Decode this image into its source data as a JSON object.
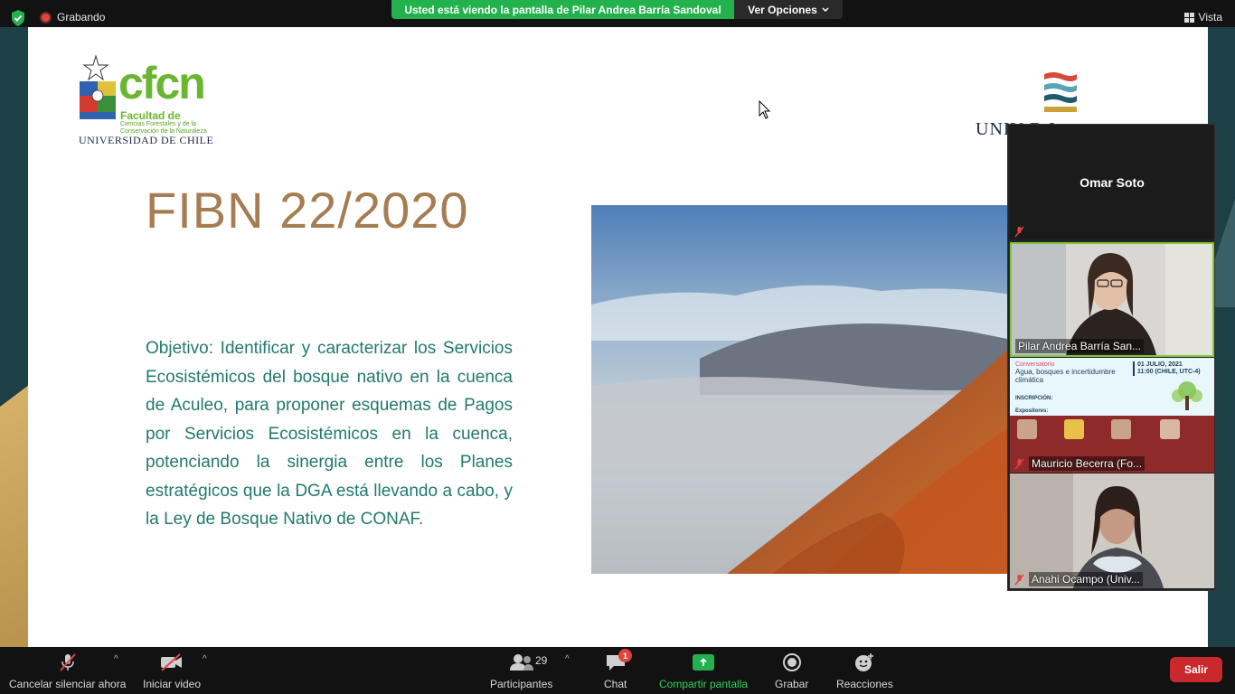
{
  "top_bar": {
    "recording_label": "Grabando",
    "share_banner": "Usted está viendo la pantalla de Pilar Andrea Barría Sandoval",
    "view_options_label": "Ver Opciones",
    "view_label": "Vista"
  },
  "slide": {
    "logo_left": {
      "brand": "cfcn",
      "faculty_line1": "Facultad de",
      "faculty_line2": "Ciencias Forestales y de la Conservación de la Naturaleza",
      "university": "UNIVERSIDAD DE CHILE"
    },
    "logo_right": {
      "text": "UNIV            D      I"
    },
    "title": "FIBN 22/2020",
    "body": "Objetivo: Identificar y caracterizar los Servicios Ecosistémicos del bosque nativo en la cuenca de Aculeo, para proponer esquemas de Pagos por Servicios Ecosistémicos en la cuenca, potenciando la sinergia entre los Planes estratégicos que la DGA está llevando a cabo, y la Ley de Bosque Nativo de CONAF."
  },
  "participants_panel": {
    "tiles": [
      {
        "name": "Omar Soto",
        "muted": true
      },
      {
        "name": "Pilar Andrea Barría San...",
        "muted": false
      },
      {
        "name": "Mauricio Becerra (Fo...",
        "muted": true
      },
      {
        "name": "Anahi Ocampo (Univ...",
        "muted": true
      }
    ],
    "flyer": {
      "kicker": "Conversatorio",
      "title": "Agua, bosques e incertidumbre climática",
      "date": "01 JULIO, 2021",
      "time": "11:00 (CHILE, UTC-4)",
      "inscription": "INSCRIPCIÓN:",
      "speakers_label": "Expositores:"
    }
  },
  "bottom_bar": {
    "mute_label": "Cancelar silenciar ahora",
    "video_label": "Iniciar video",
    "participants_label": "Participantes",
    "participants_count": "29",
    "chat_label": "Chat",
    "chat_badge": "1",
    "share_label": "Compartir pantalla",
    "record_label": "Grabar",
    "reactions_label": "Reacciones",
    "leave_label": "Salir"
  },
  "colors": {
    "share_green": "#23b14d",
    "leave_red": "#c9282d",
    "title_brown": "#a67c52",
    "body_teal": "#21796e",
    "cfcn_green": "#6ab630"
  }
}
